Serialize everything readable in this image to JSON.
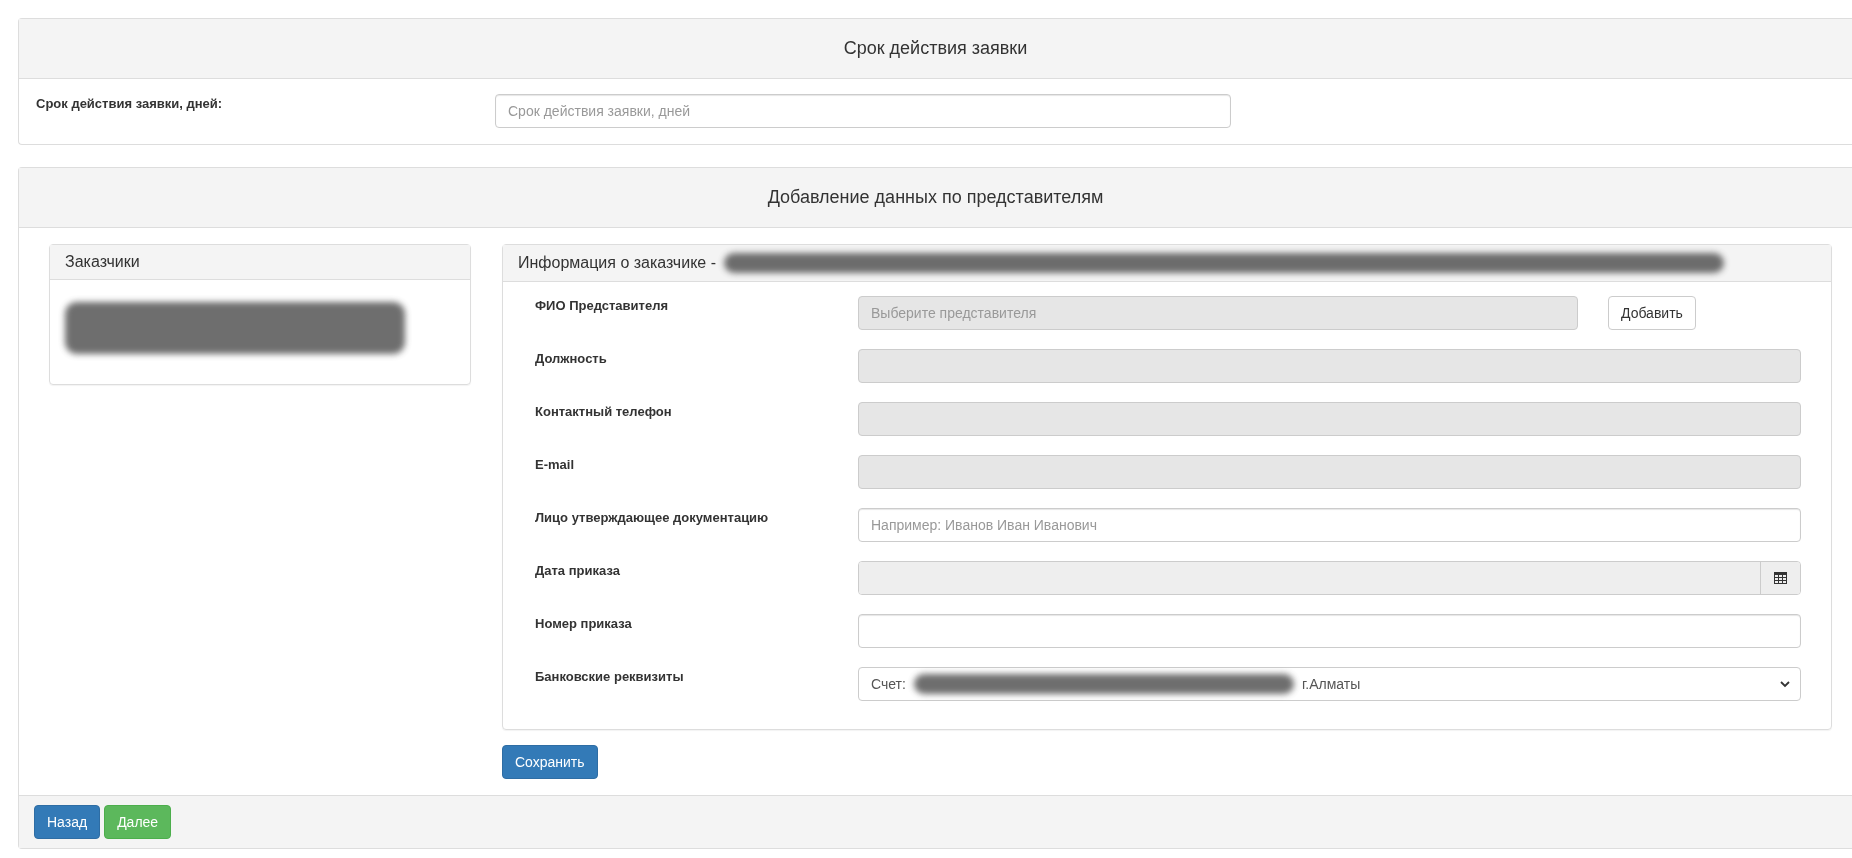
{
  "validity_panel": {
    "title": "Срок действия заявки",
    "label": "Срок действия заявки, дней:",
    "placeholder": "Срок действия заявки, дней"
  },
  "representatives_panel": {
    "title": "Добавление данных по представителям",
    "customers": {
      "title": "Заказчики",
      "items": [
        {
          "redacted": true,
          "selected": false
        }
      ]
    },
    "info": {
      "title_prefix": "Информация о заказчике -",
      "title_redacted": true,
      "fields": [
        {
          "kind": "select-add",
          "label": "ФИО Представителя",
          "placeholder": "Выберите представителя",
          "disabled": true,
          "button": "Добавить"
        },
        {
          "kind": "text",
          "label": "Должность",
          "disabled": true
        },
        {
          "kind": "text",
          "label": "Контактный телефон",
          "disabled": true
        },
        {
          "kind": "text",
          "label": "E-mail",
          "disabled": true
        },
        {
          "kind": "text",
          "label": "Лицо утверждающее документацию",
          "placeholder": "Например: Иванов Иван Иванович",
          "disabled": false
        },
        {
          "kind": "date",
          "label": "Дата приказа",
          "disabled": true
        },
        {
          "kind": "text",
          "label": "Номер приказа",
          "disabled": false
        },
        {
          "kind": "dropdown",
          "label": "Банковские реквизиты",
          "value_start": "Счет:",
          "value_end": "г.Алматы",
          "disabled": false
        }
      ]
    },
    "save_button": "Сохранить"
  },
  "footer": {
    "buttons": [
      {
        "label": "Назад",
        "kind": "primary"
      },
      {
        "label": "Далее",
        "kind": "success"
      }
    ]
  }
}
